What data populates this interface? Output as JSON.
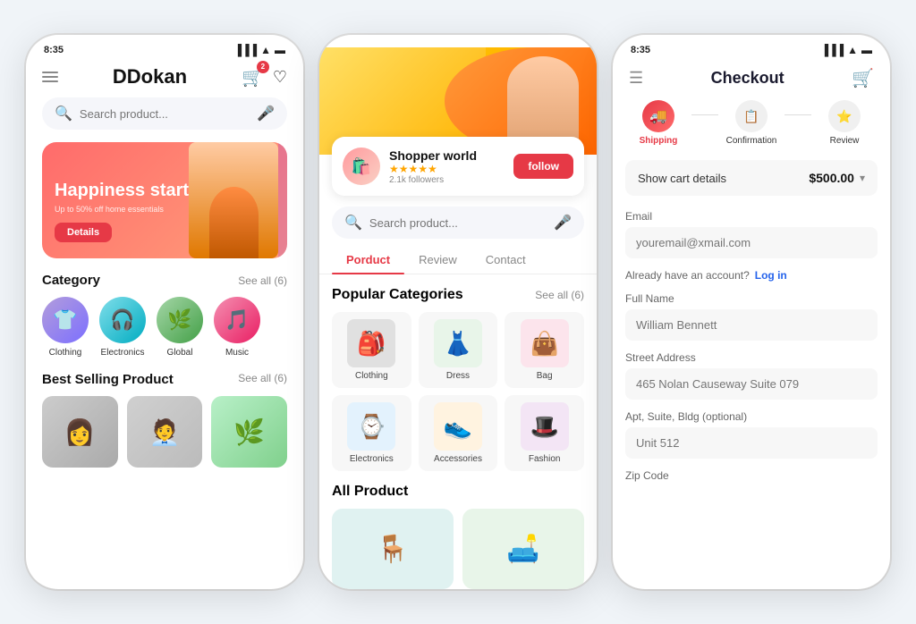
{
  "phone1": {
    "status_time": "8:35",
    "logo": "Dokan",
    "cart_count": "2",
    "search_placeholder": "Search product...",
    "banner": {
      "title": "Happiness starts at home",
      "subtitle": "Up to 50% off home essentials",
      "button_label": "Details"
    },
    "category": {
      "title": "Category",
      "see_all": "See all (6)",
      "items": [
        {
          "name": "Clothing",
          "emoji": "👕",
          "color": "cat-purple"
        },
        {
          "name": "Electronics",
          "emoji": "🎧",
          "color": "cat-cyan"
        },
        {
          "name": "Global",
          "emoji": "🌿",
          "color": "cat-green"
        },
        {
          "name": "Music",
          "emoji": "🎵",
          "color": "cat-pink"
        }
      ]
    },
    "best_selling": {
      "title": "Best Selling Product",
      "see_all": "See all (6)"
    }
  },
  "phone2": {
    "shop_name": "Shopper world",
    "shop_stars": "★★★★★",
    "shop_followers": "2.1k followers",
    "follow_label": "follow",
    "search_placeholder": "Search product...",
    "tabs": [
      {
        "label": "Porduct",
        "active": true
      },
      {
        "label": "Review",
        "active": false
      },
      {
        "label": "Contact",
        "active": false
      }
    ],
    "popular_categories": {
      "title": "Popular Categories",
      "see_all": "See all (6)",
      "items": [
        {
          "name": "Clothing",
          "emoji": "🎒"
        },
        {
          "name": "Dress",
          "emoji": "👗"
        },
        {
          "name": "Bag",
          "emoji": "👜"
        },
        {
          "name": "Electronics",
          "emoji": "⌚"
        },
        {
          "name": "Accessories",
          "emoji": "👟"
        },
        {
          "name": "Fashion",
          "emoji": "🎩"
        }
      ]
    },
    "all_product": {
      "title": "All Product",
      "items": [
        {
          "emoji": "🪑",
          "bg": "#e8f5f0"
        },
        {
          "emoji": "🛋️",
          "bg": "#e8f5e9"
        }
      ]
    }
  },
  "phone3": {
    "status_time": "8:35",
    "title": "Checkout",
    "steps": [
      {
        "label": "Shipping",
        "active": true,
        "icon": "🚚"
      },
      {
        "label": "Confirmation",
        "active": false,
        "icon": "📋"
      },
      {
        "label": "Review",
        "active": false,
        "icon": "⭐"
      }
    ],
    "cart": {
      "label": "Show cart details",
      "price": "$500.00"
    },
    "form": {
      "email_label": "Email",
      "email_placeholder": "youremail@xmail.com",
      "login_text": "Already have an account?",
      "login_link": "Log in",
      "fullname_label": "Full Name",
      "fullname_placeholder": "William Bennett",
      "street_label": "Street Address",
      "street_placeholder": "465 Nolan Causeway Suite 079",
      "apt_label": "Apt, Suite, Bldg (optional)",
      "apt_placeholder": "Unit 512",
      "zip_label": "Zip Code"
    }
  }
}
